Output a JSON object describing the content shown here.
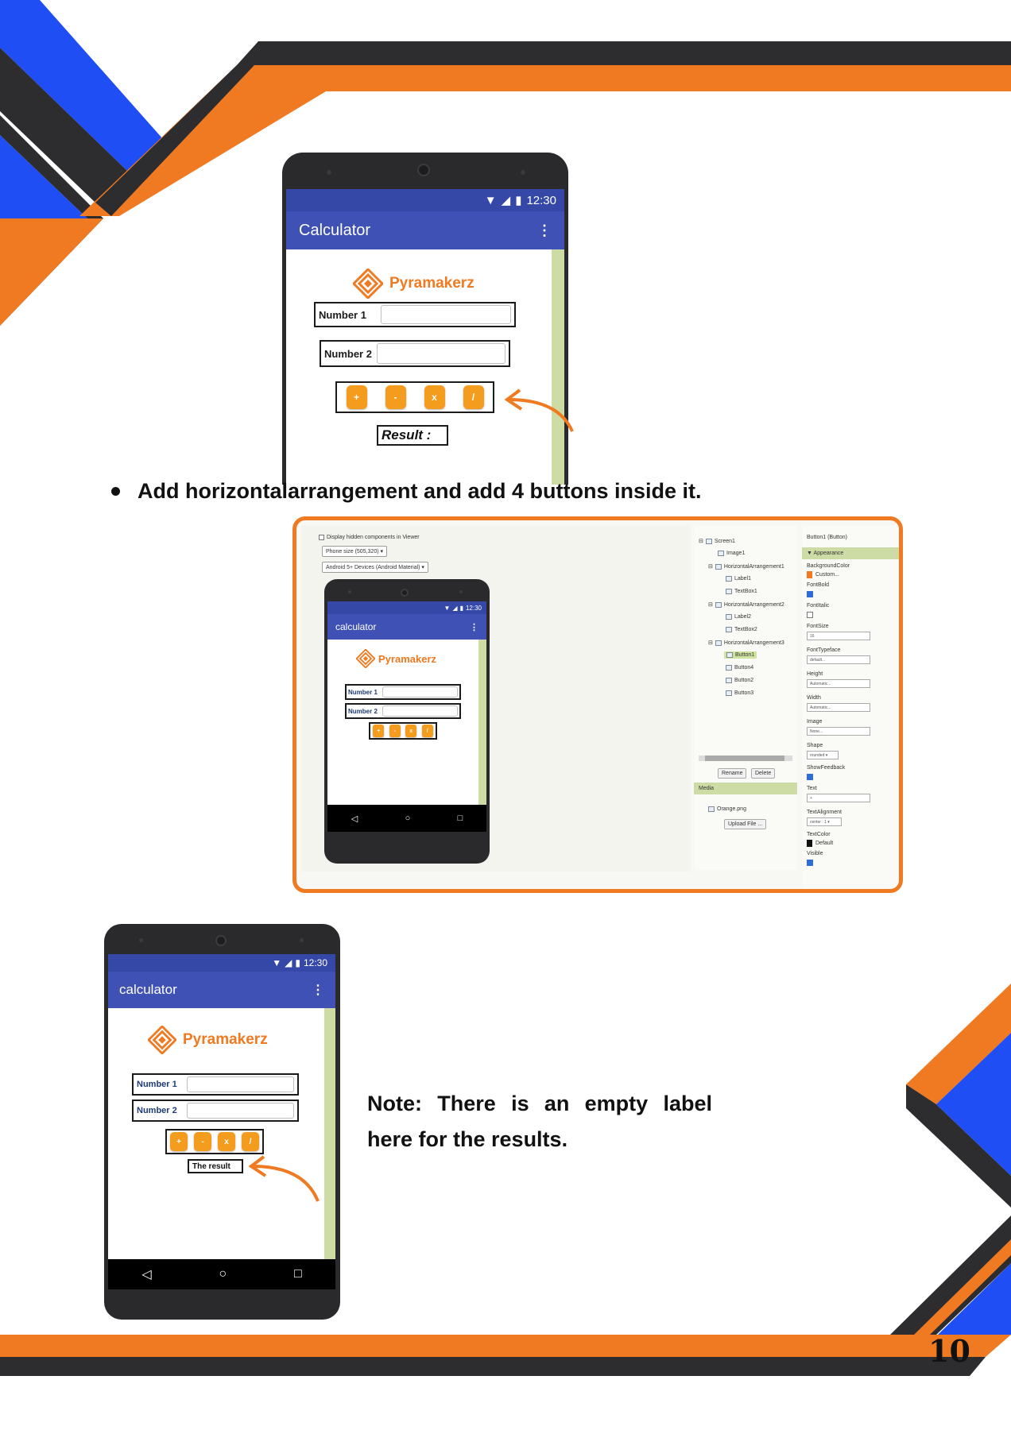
{
  "page": {
    "number": "10"
  },
  "colors": {
    "orange": "#f07a22",
    "blue": "#1f4ef5",
    "dark": "#2d2d2f",
    "app_blue": "#3f51b5",
    "button_orange": "#f39c1d",
    "sidebar_green": "#cddca4"
  },
  "top_phone": {
    "time": "12:30",
    "app_title": "Calculator",
    "menu_icon": "more-vert-icon",
    "logo_text": "Pyramakerz",
    "number1_label": "Number 1",
    "number2_label": "Number 2",
    "buttons": [
      "+",
      "-",
      "x",
      "/"
    ],
    "result_label": "Result :"
  },
  "instruction": {
    "text": "Add horizontalarrangement and add 4 buttons inside it."
  },
  "app_inventor": {
    "display_hidden": "Display hidden components in Viewer",
    "phone_size": "Phone size (505,320)",
    "theme": "Android 5+ Devices (Android Material)",
    "phone": {
      "time": "12:30",
      "app_title": "calculator",
      "logo_text": "Pyramakerz",
      "number1_label": "Number 1",
      "number2_label": "Number 2",
      "buttons": [
        "+",
        "-",
        "x",
        "/"
      ]
    },
    "components": [
      {
        "label": "Screen1",
        "indent": 0
      },
      {
        "label": "Image1",
        "indent": 1
      },
      {
        "label": "HorizontalArrangement1",
        "indent": 1
      },
      {
        "label": "Label1",
        "indent": 2
      },
      {
        "label": "TextBox1",
        "indent": 2
      },
      {
        "label": "HorizontalArrangement2",
        "indent": 1
      },
      {
        "label": "Label2",
        "indent": 2
      },
      {
        "label": "TextBox2",
        "indent": 2
      },
      {
        "label": "HorizontalArrangement3",
        "indent": 1
      },
      {
        "label": "Button1",
        "indent": 2,
        "selected": true
      },
      {
        "label": "Button4",
        "indent": 2
      },
      {
        "label": "Button2",
        "indent": 2
      },
      {
        "label": "Button3",
        "indent": 2
      }
    ],
    "rename_button": "Rename",
    "delete_button": "Delete",
    "media_header": "Media",
    "media_file": "Orange.png",
    "upload_button": "Upload File ...",
    "properties_title": "Button1 (Button)",
    "appearance_header": "Appearance",
    "properties": {
      "background_color_label": "BackgroundColor",
      "background_color_value": "Custom...",
      "font_bold_label": "FontBold",
      "font_italic_label": "FontItalic",
      "font_size_label": "FontSize",
      "font_size_value": "16",
      "font_typeface_label": "FontTypeface",
      "font_typeface_value": "default...",
      "height_label": "Height",
      "height_value": "Automatic...",
      "width_label": "Width",
      "width_value": "Automatic...",
      "image_label": "Image",
      "image_value": "None...",
      "shape_label": "Shape",
      "shape_value": "rounded",
      "show_feedback_label": "ShowFeedback",
      "text_label": "Text",
      "text_value": "+",
      "text_alignment_label": "TextAlignment",
      "text_alignment_value": "center : 1",
      "text_color_label": "TextColor",
      "text_color_value": "Default",
      "visible_label": "Visible"
    }
  },
  "bottom_phone": {
    "time": "12:30",
    "app_title": "calculator",
    "logo_text": "Pyramakerz",
    "number1_label": "Number 1",
    "number2_label": "Number 2",
    "buttons": [
      "+",
      "-",
      "x",
      "/"
    ],
    "result_label": "The result"
  },
  "note": {
    "text": "Note: There is an empty label here for the results."
  }
}
